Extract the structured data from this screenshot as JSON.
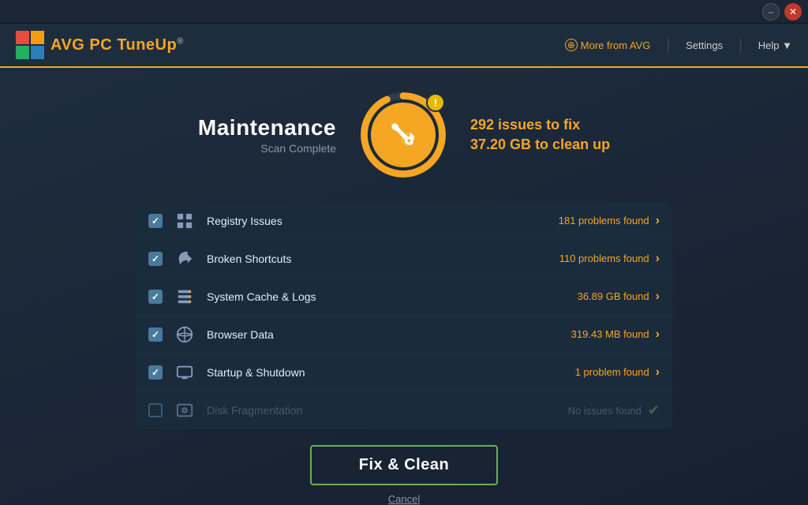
{
  "app": {
    "title": "AVG PC TuneUp",
    "logo_avg": "AVG",
    "logo_app": "PC TuneUp",
    "logo_registered": "®"
  },
  "header": {
    "more_from_avg": "More from AVG",
    "settings": "Settings",
    "help": "Help ▼"
  },
  "titlebar": {
    "minimize": "–",
    "close": "✕"
  },
  "hero": {
    "title": "Maintenance",
    "subtitle": "Scan Complete",
    "issues_count": "292 issues",
    "issues_suffix": " to fix",
    "storage_amount": "37.20 GB",
    "storage_suffix": " to clean up",
    "alert_symbol": "!"
  },
  "results": [
    {
      "id": "registry",
      "checked": true,
      "label": "Registry Issues",
      "result": "181 problems found",
      "has_chevron": true,
      "disabled": false
    },
    {
      "id": "shortcuts",
      "checked": true,
      "label": "Broken Shortcuts",
      "result": "110 problems found",
      "has_chevron": true,
      "disabled": false
    },
    {
      "id": "cache",
      "checked": true,
      "label": "System Cache & Logs",
      "result": "36.89 GB found",
      "has_chevron": true,
      "disabled": false
    },
    {
      "id": "browser",
      "checked": true,
      "label": "Browser Data",
      "result": "319.43 MB found",
      "has_chevron": true,
      "disabled": false
    },
    {
      "id": "startup",
      "checked": true,
      "label": "Startup & Shutdown",
      "result": "1 problem found",
      "has_chevron": true,
      "disabled": false
    },
    {
      "id": "disk",
      "checked": false,
      "label": "Disk Fragmentation",
      "result": "No issues found",
      "has_chevron": false,
      "disabled": true
    }
  ],
  "actions": {
    "fix_clean": "Fix & Clean",
    "cancel": "Cancel"
  }
}
